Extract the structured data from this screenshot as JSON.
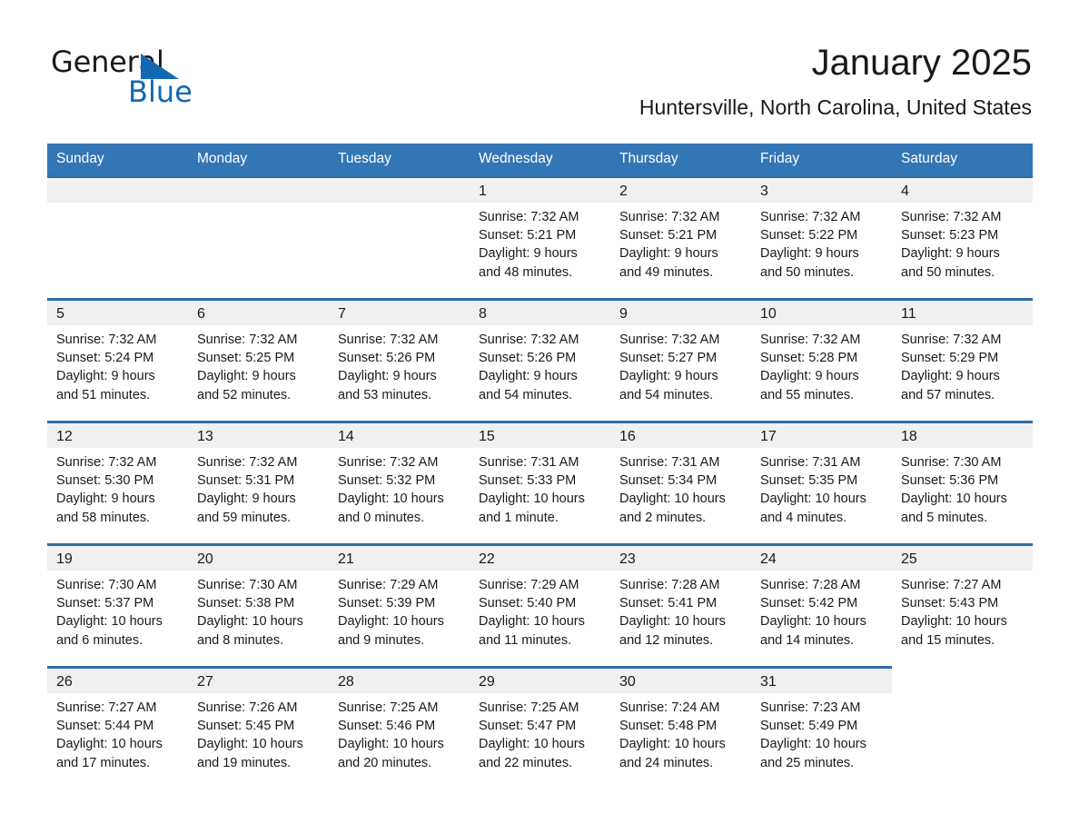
{
  "brand": {
    "name_part1": "General",
    "name_part2": "Blue",
    "accent_color": "#1268B3"
  },
  "header": {
    "title": "January 2025",
    "subtitle": "Huntersville, North Carolina, United States"
  },
  "theme": {
    "header_bar_color": "#3376B5",
    "row_rule_color": "#2E6DA8",
    "daynum_strip_color": "#F0F0F0"
  },
  "calendar": {
    "weekday_headers": [
      "Sunday",
      "Monday",
      "Tuesday",
      "Wednesday",
      "Thursday",
      "Friday",
      "Saturday"
    ],
    "labels": {
      "sunrise_prefix": "Sunrise:",
      "sunset_prefix": "Sunset:",
      "daylight_prefix": "Daylight:"
    },
    "weeks": [
      [
        {
          "day": "",
          "blank": true
        },
        {
          "day": "",
          "blank": true
        },
        {
          "day": "",
          "blank": true
        },
        {
          "day": "1",
          "sunrise": "Sunrise: 7:32 AM",
          "sunset": "Sunset: 5:21 PM",
          "daylight": "Daylight: 9 hours and 48 minutes."
        },
        {
          "day": "2",
          "sunrise": "Sunrise: 7:32 AM",
          "sunset": "Sunset: 5:21 PM",
          "daylight": "Daylight: 9 hours and 49 minutes."
        },
        {
          "day": "3",
          "sunrise": "Sunrise: 7:32 AM",
          "sunset": "Sunset: 5:22 PM",
          "daylight": "Daylight: 9 hours and 50 minutes."
        },
        {
          "day": "4",
          "sunrise": "Sunrise: 7:32 AM",
          "sunset": "Sunset: 5:23 PM",
          "daylight": "Daylight: 9 hours and 50 minutes."
        }
      ],
      [
        {
          "day": "5",
          "sunrise": "Sunrise: 7:32 AM",
          "sunset": "Sunset: 5:24 PM",
          "daylight": "Daylight: 9 hours and 51 minutes."
        },
        {
          "day": "6",
          "sunrise": "Sunrise: 7:32 AM",
          "sunset": "Sunset: 5:25 PM",
          "daylight": "Daylight: 9 hours and 52 minutes."
        },
        {
          "day": "7",
          "sunrise": "Sunrise: 7:32 AM",
          "sunset": "Sunset: 5:26 PM",
          "daylight": "Daylight: 9 hours and 53 minutes."
        },
        {
          "day": "8",
          "sunrise": "Sunrise: 7:32 AM",
          "sunset": "Sunset: 5:26 PM",
          "daylight": "Daylight: 9 hours and 54 minutes."
        },
        {
          "day": "9",
          "sunrise": "Sunrise: 7:32 AM",
          "sunset": "Sunset: 5:27 PM",
          "daylight": "Daylight: 9 hours and 54 minutes."
        },
        {
          "day": "10",
          "sunrise": "Sunrise: 7:32 AM",
          "sunset": "Sunset: 5:28 PM",
          "daylight": "Daylight: 9 hours and 55 minutes."
        },
        {
          "day": "11",
          "sunrise": "Sunrise: 7:32 AM",
          "sunset": "Sunset: 5:29 PM",
          "daylight": "Daylight: 9 hours and 57 minutes."
        }
      ],
      [
        {
          "day": "12",
          "sunrise": "Sunrise: 7:32 AM",
          "sunset": "Sunset: 5:30 PM",
          "daylight": "Daylight: 9 hours and 58 minutes."
        },
        {
          "day": "13",
          "sunrise": "Sunrise: 7:32 AM",
          "sunset": "Sunset: 5:31 PM",
          "daylight": "Daylight: 9 hours and 59 minutes."
        },
        {
          "day": "14",
          "sunrise": "Sunrise: 7:32 AM",
          "sunset": "Sunset: 5:32 PM",
          "daylight": "Daylight: 10 hours and 0 minutes."
        },
        {
          "day": "15",
          "sunrise": "Sunrise: 7:31 AM",
          "sunset": "Sunset: 5:33 PM",
          "daylight": "Daylight: 10 hours and 1 minute."
        },
        {
          "day": "16",
          "sunrise": "Sunrise: 7:31 AM",
          "sunset": "Sunset: 5:34 PM",
          "daylight": "Daylight: 10 hours and 2 minutes."
        },
        {
          "day": "17",
          "sunrise": "Sunrise: 7:31 AM",
          "sunset": "Sunset: 5:35 PM",
          "daylight": "Daylight: 10 hours and 4 minutes."
        },
        {
          "day": "18",
          "sunrise": "Sunrise: 7:30 AM",
          "sunset": "Sunset: 5:36 PM",
          "daylight": "Daylight: 10 hours and 5 minutes."
        }
      ],
      [
        {
          "day": "19",
          "sunrise": "Sunrise: 7:30 AM",
          "sunset": "Sunset: 5:37 PM",
          "daylight": "Daylight: 10 hours and 6 minutes."
        },
        {
          "day": "20",
          "sunrise": "Sunrise: 7:30 AM",
          "sunset": "Sunset: 5:38 PM",
          "daylight": "Daylight: 10 hours and 8 minutes."
        },
        {
          "day": "21",
          "sunrise": "Sunrise: 7:29 AM",
          "sunset": "Sunset: 5:39 PM",
          "daylight": "Daylight: 10 hours and 9 minutes."
        },
        {
          "day": "22",
          "sunrise": "Sunrise: 7:29 AM",
          "sunset": "Sunset: 5:40 PM",
          "daylight": "Daylight: 10 hours and 11 minutes."
        },
        {
          "day": "23",
          "sunrise": "Sunrise: 7:28 AM",
          "sunset": "Sunset: 5:41 PM",
          "daylight": "Daylight: 10 hours and 12 minutes."
        },
        {
          "day": "24",
          "sunrise": "Sunrise: 7:28 AM",
          "sunset": "Sunset: 5:42 PM",
          "daylight": "Daylight: 10 hours and 14 minutes."
        },
        {
          "day": "25",
          "sunrise": "Sunrise: 7:27 AM",
          "sunset": "Sunset: 5:43 PM",
          "daylight": "Daylight: 10 hours and 15 minutes."
        }
      ],
      [
        {
          "day": "26",
          "sunrise": "Sunrise: 7:27 AM",
          "sunset": "Sunset: 5:44 PM",
          "daylight": "Daylight: 10 hours and 17 minutes."
        },
        {
          "day": "27",
          "sunrise": "Sunrise: 7:26 AM",
          "sunset": "Sunset: 5:45 PM",
          "daylight": "Daylight: 10 hours and 19 minutes."
        },
        {
          "day": "28",
          "sunrise": "Sunrise: 7:25 AM",
          "sunset": "Sunset: 5:46 PM",
          "daylight": "Daylight: 10 hours and 20 minutes."
        },
        {
          "day": "29",
          "sunrise": "Sunrise: 7:25 AM",
          "sunset": "Sunset: 5:47 PM",
          "daylight": "Daylight: 10 hours and 22 minutes."
        },
        {
          "day": "30",
          "sunrise": "Sunrise: 7:24 AM",
          "sunset": "Sunset: 5:48 PM",
          "daylight": "Daylight: 10 hours and 24 minutes."
        },
        {
          "day": "31",
          "sunrise": "Sunrise: 7:23 AM",
          "sunset": "Sunset: 5:49 PM",
          "daylight": "Daylight: 10 hours and 25 minutes."
        },
        {
          "day": "",
          "empty_tail": true
        }
      ]
    ]
  }
}
